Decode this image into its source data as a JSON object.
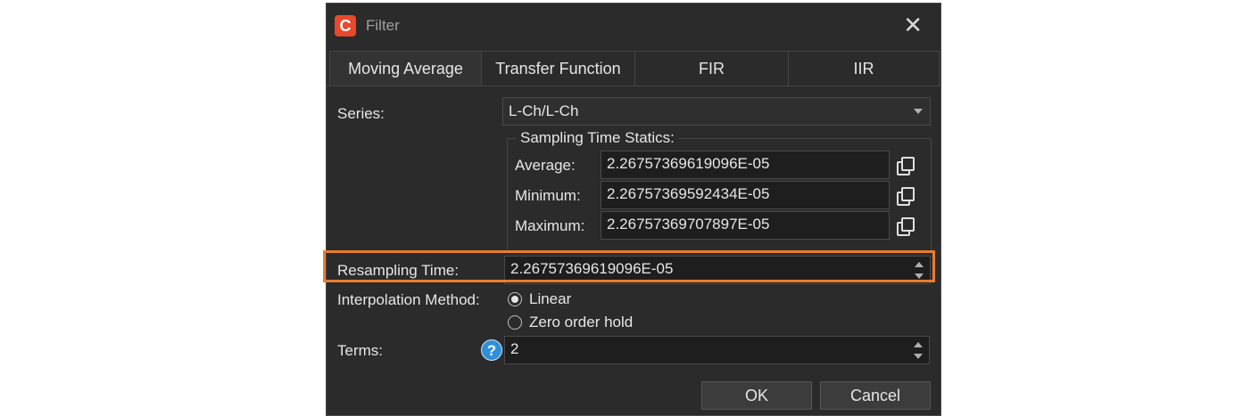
{
  "window": {
    "title": "Filter",
    "app_icon": "C",
    "close_glyph": "✕"
  },
  "tabs": [
    {
      "label": "Moving Average",
      "active": true
    },
    {
      "label": "Transfer Function",
      "active": false
    },
    {
      "label": "FIR",
      "active": false
    },
    {
      "label": "IIR",
      "active": false
    }
  ],
  "series": {
    "label": "Series:",
    "value": "L-Ch/L-Ch"
  },
  "sampling": {
    "group_title": "Sampling Time Statics:",
    "average_label": "Average:",
    "average_value": "2.26757369619096E-05",
    "minimum_label": "Minimum:",
    "minimum_value": "2.26757369592434E-05",
    "maximum_label": "Maximum:",
    "maximum_value": "2.26757369707897E-05"
  },
  "resampling": {
    "label": "Resampling Time:",
    "value": "2.26757369619096E-05"
  },
  "interpolation": {
    "label": "Interpolation Method:",
    "options": [
      {
        "label": "Linear",
        "checked": true
      },
      {
        "label": "Zero order hold",
        "checked": false
      }
    ]
  },
  "terms": {
    "label": "Terms:",
    "value": "2",
    "help_glyph": "?"
  },
  "buttons": {
    "ok": "OK",
    "cancel": "Cancel"
  },
  "colors": {
    "highlight": "#e87d2f",
    "help": "#2f8fd8",
    "dialog_bg": "#2b2b2b"
  }
}
